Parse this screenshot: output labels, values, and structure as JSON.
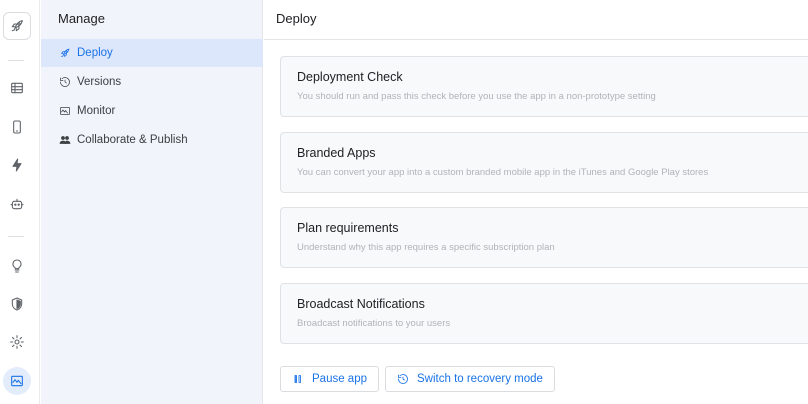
{
  "rail": {
    "icons": [
      "rocket-icon",
      "table-icon",
      "phone-icon",
      "bolt-icon",
      "bot-icon",
      "lightbulb-icon",
      "shield-icon",
      "gear-icon",
      "monitor-icon"
    ]
  },
  "sidebar": {
    "title": "Manage",
    "items": [
      {
        "label": "Deploy",
        "icon": "rocket-icon",
        "active": true
      },
      {
        "label": "Versions",
        "icon": "history-icon",
        "active": false
      },
      {
        "label": "Monitor",
        "icon": "monitor-icon",
        "active": false
      },
      {
        "label": "Collaborate & Publish",
        "icon": "people-icon",
        "active": false
      }
    ]
  },
  "main": {
    "title": "Deploy",
    "cards": [
      {
        "title": "Deployment Check",
        "description": "You should run and pass this check before you use the app in a non-prototype setting"
      },
      {
        "title": "Branded Apps",
        "description": "You can convert your app into a custom branded mobile app in the iTunes and Google Play stores"
      },
      {
        "title": "Plan requirements",
        "description": "Understand why this app requires a specific subscription plan"
      },
      {
        "title": "Broadcast Notifications",
        "description": "Broadcast notifications to your users"
      }
    ],
    "actions": {
      "pause_label": "Pause app",
      "recovery_label": "Switch to recovery mode"
    }
  },
  "colors": {
    "accent": "#1a73e8",
    "panel_bg": "#f1f4fa",
    "active_item_bg": "#dce7fb"
  }
}
